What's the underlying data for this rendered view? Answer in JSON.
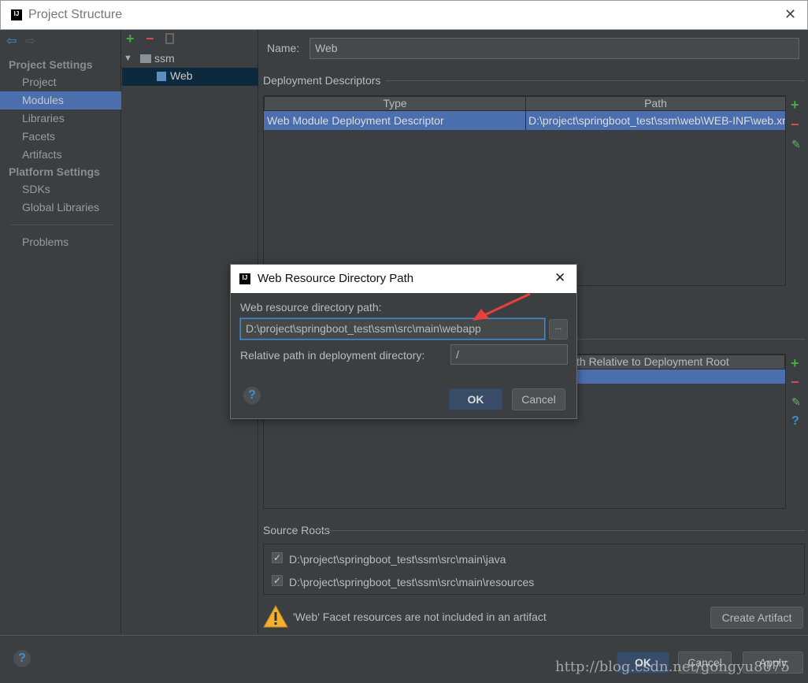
{
  "window": {
    "title": "Project Structure",
    "close": "✕",
    "app_icon": "IJ"
  },
  "sidebar": {
    "sections": [
      {
        "header": "Project Settings",
        "items": [
          {
            "label": "Project"
          },
          {
            "label": "Modules",
            "selected": true
          },
          {
            "label": "Libraries"
          },
          {
            "label": "Facets"
          },
          {
            "label": "Artifacts"
          }
        ]
      },
      {
        "header": "Platform Settings",
        "items": [
          {
            "label": "SDKs"
          },
          {
            "label": "Global Libraries"
          }
        ]
      }
    ],
    "problems": "Problems"
  },
  "tree": {
    "root": "ssm",
    "child": "Web"
  },
  "main": {
    "name_label": "Name:",
    "name_value": "Web",
    "deployment_descriptors": {
      "title": "Deployment Descriptors",
      "columns": [
        "Type",
        "Path"
      ],
      "rows": [
        [
          "Web Module Deployment Descriptor",
          "D:\\project\\springboot_test\\ssm\\web\\WEB-INF\\web.xml"
        ]
      ]
    },
    "web_resource_dirs": {
      "partial_column": "th Relative to Deployment Root"
    },
    "source_roots": {
      "title": "Source Roots",
      "items": [
        {
          "path": "D:\\project\\springboot_test\\ssm\\src\\main\\java",
          "checked": true
        },
        {
          "path": "D:\\project\\springboot_test\\ssm\\src\\main\\resources",
          "checked": true
        }
      ]
    },
    "warning": "'Web' Facet resources are not included in an artifact",
    "create_artifact": "Create Artifact"
  },
  "footer": {
    "ok": "OK",
    "cancel": "Cancel",
    "apply": "Apply",
    "help": "?"
  },
  "dialog": {
    "title": "Web Resource Directory Path",
    "close": "✕",
    "path_label": "Web resource directory path:",
    "path_value": "D:\\project\\springboot_test\\ssm\\src\\main\\webapp",
    "browse": "...",
    "relative_label": "Relative path in deployment directory:",
    "relative_value": "/",
    "ok": "OK",
    "cancel": "Cancel",
    "help": "?"
  },
  "watermark": "http://blog.csdn.net/gongyu8075",
  "colors": {
    "selection": "#4b6eaf",
    "background": "#3c3f41",
    "add": "#3fae3f",
    "remove": "#d05050",
    "arrow": "#e8403a"
  }
}
